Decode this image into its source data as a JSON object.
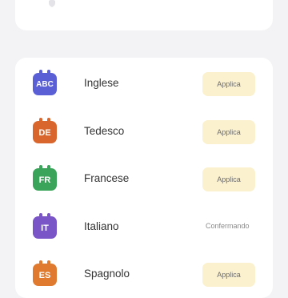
{
  "languages": [
    {
      "code": "ABC",
      "name": "Inglese",
      "action": "Applica",
      "color": "#5a5fd6"
    },
    {
      "code": "DE",
      "name": "Tedesco",
      "action": "Applica",
      "color": "#d9662c"
    },
    {
      "code": "FR",
      "name": "Francese",
      "action": "Applica",
      "color": "#3aa55a"
    },
    {
      "code": "IT",
      "name": "Italiano",
      "status": "Confermando",
      "color": "#7a55c8"
    },
    {
      "code": "ES",
      "name": "Spagnolo",
      "action": "Applica",
      "color": "#e07a2e"
    }
  ],
  "colors": {
    "background": "#f3f3f5",
    "card": "#ffffff",
    "apply_button": "#fbf1cf"
  }
}
